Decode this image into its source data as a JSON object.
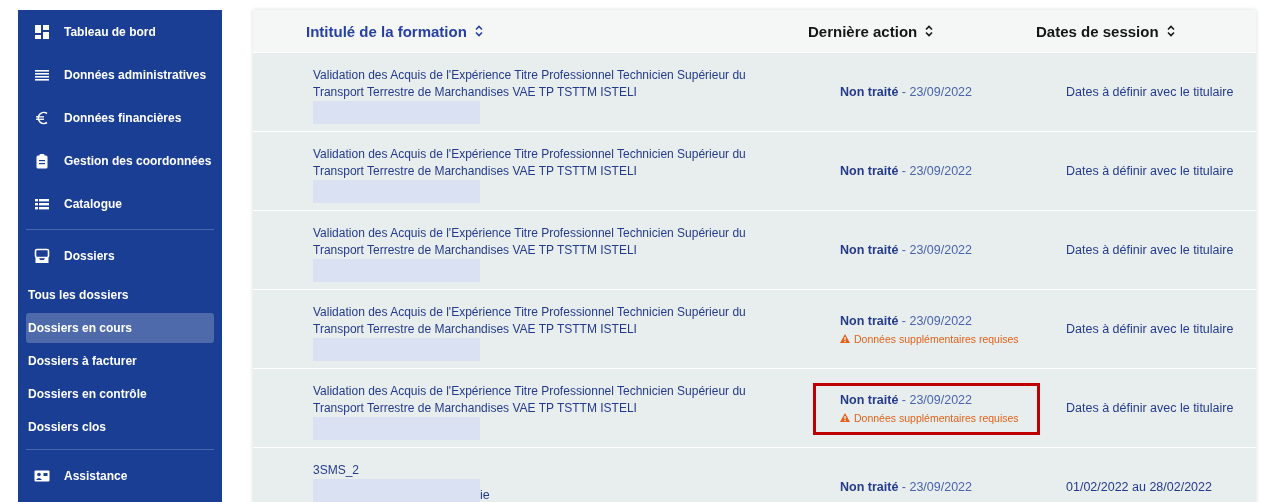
{
  "sidebar": {
    "groups": [
      [
        {
          "label": "Tableau de bord",
          "kind": "main",
          "selected": false
        },
        {
          "label": "Données administratives",
          "kind": "main",
          "selected": false
        },
        {
          "label": "Données financières",
          "kind": "main",
          "selected": false
        },
        {
          "label": "Gestion des coordonnées",
          "kind": "main",
          "selected": false
        },
        {
          "label": "Catalogue",
          "kind": "main",
          "selected": false
        }
      ],
      [
        {
          "label": "Dossiers",
          "kind": "main",
          "selected": false
        },
        {
          "label": "Tous les dossiers",
          "kind": "sub",
          "selected": false
        },
        {
          "label": "Dossiers en cours",
          "kind": "sub",
          "selected": true
        },
        {
          "label": "Dossiers à facturer",
          "kind": "sub",
          "selected": false
        },
        {
          "label": "Dossiers en contrôle",
          "kind": "sub",
          "selected": false
        },
        {
          "label": "Dossiers clos",
          "kind": "sub",
          "selected": false
        }
      ],
      [
        {
          "label": "Assistance",
          "kind": "main",
          "selected": false
        }
      ]
    ]
  },
  "table": {
    "columns": [
      "Intitulé de la formation",
      "Dernière action",
      "Dates de session"
    ],
    "rows": [
      {
        "title": "Validation des Acquis de l'Expérience Titre Professionnel Technicien Supérieur du Transport Terrestre de Marchandises VAE TP TSTTM ISTELI",
        "status": "Non traité",
        "date": "- 23/09/2022",
        "warning": null,
        "highlighted": false,
        "session": "Dates à définir avec le titulaire"
      },
      {
        "title": "Validation des Acquis de l'Expérience Titre Professionnel Technicien Supérieur du Transport Terrestre de Marchandises VAE TP TSTTM ISTELI",
        "status": "Non traité",
        "date": "- 23/09/2022",
        "warning": null,
        "highlighted": false,
        "session": "Dates à définir avec le titulaire"
      },
      {
        "title": "Validation des Acquis de l'Expérience Titre Professionnel Technicien Supérieur du Transport Terrestre de Marchandises VAE TP TSTTM ISTELI",
        "status": "Non traité",
        "date": "- 23/09/2022",
        "warning": null,
        "highlighted": false,
        "session": "Dates à définir avec le titulaire"
      },
      {
        "title": "Validation des Acquis de l'Expérience Titre Professionnel Technicien Supérieur du Transport Terrestre de Marchandises VAE TP TSTTM ISTELI",
        "status": "Non traité",
        "date": "- 23/09/2022",
        "warning": "Données supplémentaires requises",
        "highlighted": false,
        "session": "Dates à définir avec le titulaire"
      },
      {
        "title": "Validation des Acquis de l'Expérience Titre Professionnel Technicien Supérieur du Transport Terrestre de Marchandises VAE TP TSTTM ISTELI",
        "status": "Non traité",
        "date": "- 23/09/2022",
        "warning": "Données supplémentaires requises",
        "highlighted": true,
        "session": "Dates à définir avec le titulaire"
      },
      {
        "title": "3SMS_2",
        "status": "Non traité",
        "date": "- 23/09/2022",
        "warning": null,
        "highlighted": false,
        "session": "01/02/2022 au 28/02/2022",
        "trailing": "ie"
      }
    ]
  }
}
